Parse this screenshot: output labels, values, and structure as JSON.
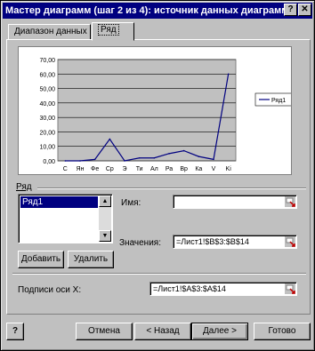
{
  "window": {
    "title": "Мастер диаграмм (шаг 2 из 4): источник данных диаграммы",
    "help_label": "?",
    "close_label": "✕"
  },
  "tabs": [
    {
      "label": "Диапазон данных",
      "active": false
    },
    {
      "label": "Ряд",
      "active": true
    }
  ],
  "series_section": {
    "label": "Ряд",
    "list_items": [
      "Ряд1"
    ],
    "add_button": "Добавить",
    "remove_button": "Удалить"
  },
  "fields": {
    "name_label": "Имя:",
    "name_value": "",
    "values_label": "Значения:",
    "values_value": "=Лист1!$B$3:$B$14",
    "xlabels_label": "Подписи оси X:",
    "xlabels_value": "=Лист1!$A$3:$A$14"
  },
  "footer": {
    "help_glyph": "?",
    "cancel": "Отмена",
    "back": "< Назад",
    "next": "Далее >",
    "finish": "Готово"
  },
  "chart_data": {
    "type": "line",
    "categories": [
      "С",
      "Ян",
      "Фе",
      "Ср",
      "Э",
      "Ти",
      "Ал",
      "Ра",
      "Вр",
      "Ка",
      "V",
      "Ki"
    ],
    "series": [
      {
        "name": "Ряд1",
        "values": [
          0,
          0,
          1,
          15,
          0,
          2,
          2,
          5,
          7,
          3,
          1,
          60
        ]
      }
    ],
    "ylim": [
      0,
      70
    ],
    "yticks": [
      "70,00",
      "60,00",
      "50,00",
      "40,00",
      "30,00",
      "20,00",
      "10,00",
      "0,00"
    ],
    "grid": true,
    "legend_position": "right",
    "colors": {
      "plot_bg": "#c0c0c0",
      "line": "#000080"
    }
  }
}
